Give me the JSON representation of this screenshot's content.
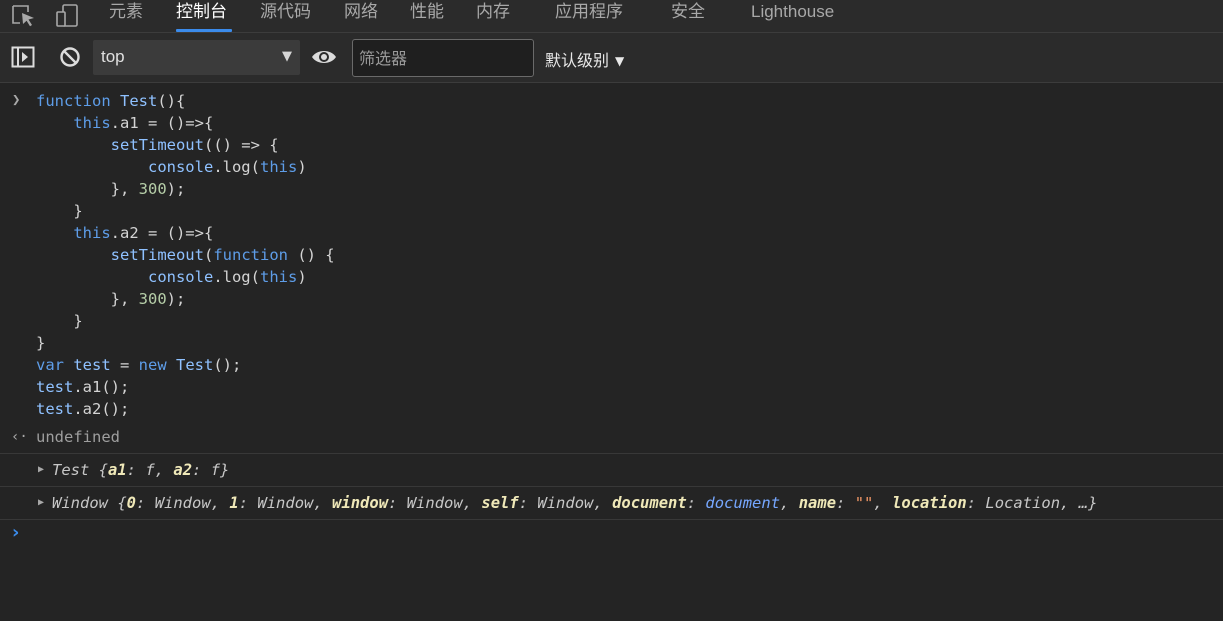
{
  "tabs": [
    {
      "label": "元素"
    },
    {
      "label": "控制台"
    },
    {
      "label": "源代码"
    },
    {
      "label": "网络"
    },
    {
      "label": "性能"
    },
    {
      "label": "内存"
    },
    {
      "label": "应用程序"
    },
    {
      "label": "安全"
    },
    {
      "label": "Lighthouse"
    }
  ],
  "active_tab": "控制台",
  "toolbar": {
    "context_value": "top",
    "filter_placeholder": "筛选器",
    "levels_label": "默认级别"
  },
  "icons": {
    "inspect": "inspect-element-icon",
    "device": "device-toolbar-icon",
    "sidebar": "toggle-sidebar-icon",
    "clear": "clear-console-icon",
    "eye": "live-expression-icon",
    "dropdown": "dropdown-triangle-icon",
    "prompt": "chevron-right-icon",
    "return": "return-arrow-icon",
    "expand": "expand-triangle-icon"
  },
  "colors": {
    "keyword": "#5e9de8",
    "function_name": "#8fc1ff",
    "number": "#b6cea8",
    "accent": "#3b8beb"
  },
  "console": {
    "code": {
      "l1": {
        "kw": "function",
        "name": "Test",
        "rest": "(){"
      },
      "l2": {
        "indent": "    ",
        "kw": "this",
        "rest": ".a1 = ()=>{"
      },
      "l3": {
        "indent": "        ",
        "fn": "setTimeout",
        "rest": "(() => {"
      },
      "l4": {
        "indent": "            ",
        "fn": "console",
        "mid": ".log(",
        "kw": "this",
        "end": ")"
      },
      "l5": {
        "indent": "        ",
        "pre": "}, ",
        "num": "300",
        "post": ");"
      },
      "l6": {
        "text": "    }"
      },
      "l7": {
        "indent": "    ",
        "kw": "this",
        "rest": ".a2 = ()=>{"
      },
      "l8": {
        "indent": "        ",
        "fn": "setTimeout",
        "mid": "(",
        "kw": "function",
        "rest": " () {"
      },
      "l9": {
        "indent": "            ",
        "fn": "console",
        "mid": ".log(",
        "kw": "this",
        "end": ")"
      },
      "l10": {
        "indent": "        ",
        "pre": "}, ",
        "num": "300",
        "post": ");"
      },
      "l11": {
        "text": "    }"
      },
      "l12": {
        "text": "}"
      },
      "l13": {
        "kw": "var",
        "v": " test",
        "op": " = ",
        "kw2": "new",
        "name": " Test",
        "end": "();"
      },
      "l14": {
        "obj": "test",
        "rest": ".a1();"
      },
      "l15": {
        "obj": "test",
        "rest": ".a2();"
      }
    },
    "result": "undefined",
    "logs": {
      "test": {
        "name": "Test",
        "open": " {",
        "k1": "a1",
        "v1": "f",
        "k2": "a2",
        "v2": "f",
        "close": "}"
      },
      "window": {
        "name": "Window",
        "open": " {",
        "props": [
          {
            "key": "0",
            "value": "Window",
            "kind": "plain"
          },
          {
            "key": "1",
            "value": "Window",
            "kind": "plain"
          },
          {
            "key": "window",
            "value": "Window",
            "kind": "plain"
          },
          {
            "key": "self",
            "value": "Window",
            "kind": "plain"
          },
          {
            "key": "document",
            "value": "document",
            "kind": "link"
          },
          {
            "key": "name",
            "value": "\"\"",
            "kind": "string"
          },
          {
            "key": "location",
            "value": "Location",
            "kind": "plain"
          }
        ],
        "ellipsis": "…",
        "close": "}"
      }
    }
  }
}
